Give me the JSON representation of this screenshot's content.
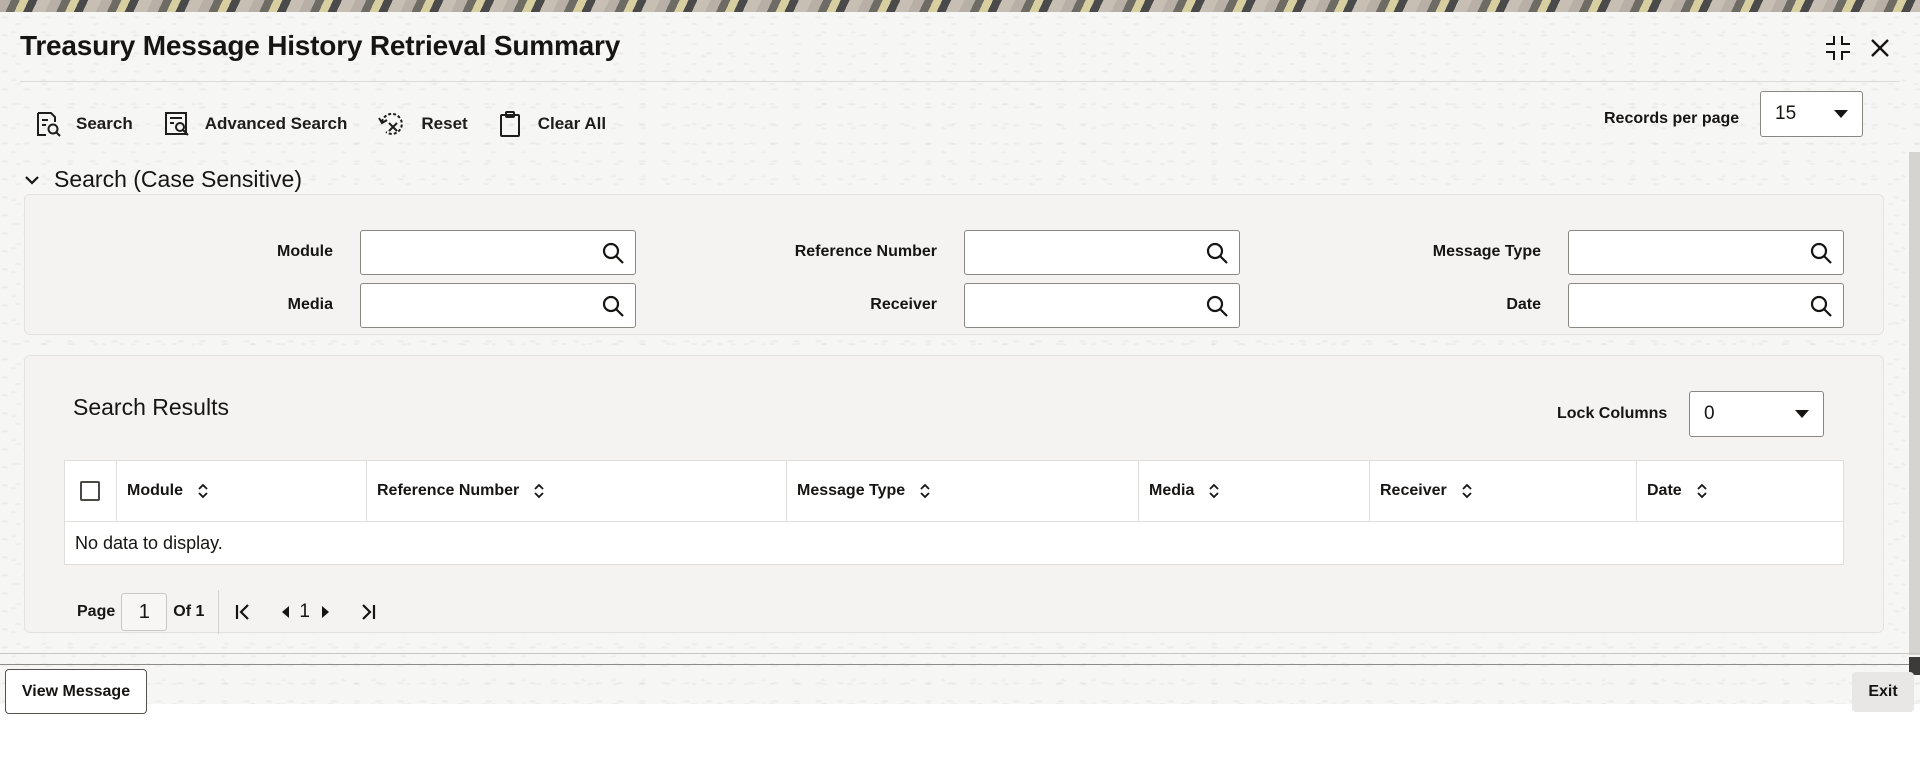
{
  "window": {
    "title": "Treasury Message History Retrieval Summary",
    "controls": {
      "minimize_icon": "collapse-icon",
      "close_icon": "close-icon"
    }
  },
  "toolbar": {
    "search_label": "Search",
    "advanced_search_label": "Advanced Search",
    "reset_label": "Reset",
    "clear_all_label": "Clear All",
    "records_per_page_label": "Records per page",
    "records_per_page_value": "15"
  },
  "search_section": {
    "title": "Search (Case Sensitive)",
    "fields": {
      "module": {
        "label": "Module",
        "value": ""
      },
      "reference_number": {
        "label": "Reference Number",
        "value": ""
      },
      "message_type": {
        "label": "Message Type",
        "value": ""
      },
      "media": {
        "label": "Media",
        "value": ""
      },
      "receiver": {
        "label": "Receiver",
        "value": ""
      },
      "date": {
        "label": "Date",
        "value": ""
      }
    }
  },
  "results": {
    "title": "Search Results",
    "lock_columns_label": "Lock Columns",
    "lock_columns_value": "0",
    "columns": [
      "Module",
      "Reference Number",
      "Message Type",
      "Media",
      "Receiver",
      "Date"
    ],
    "empty_message": "No data to display."
  },
  "pager": {
    "page_label": "Page",
    "current_page": "1",
    "of_label": "Of 1",
    "page_link": "1"
  },
  "footer": {
    "view_message_label": "View Message",
    "exit_label": "Exit"
  }
}
